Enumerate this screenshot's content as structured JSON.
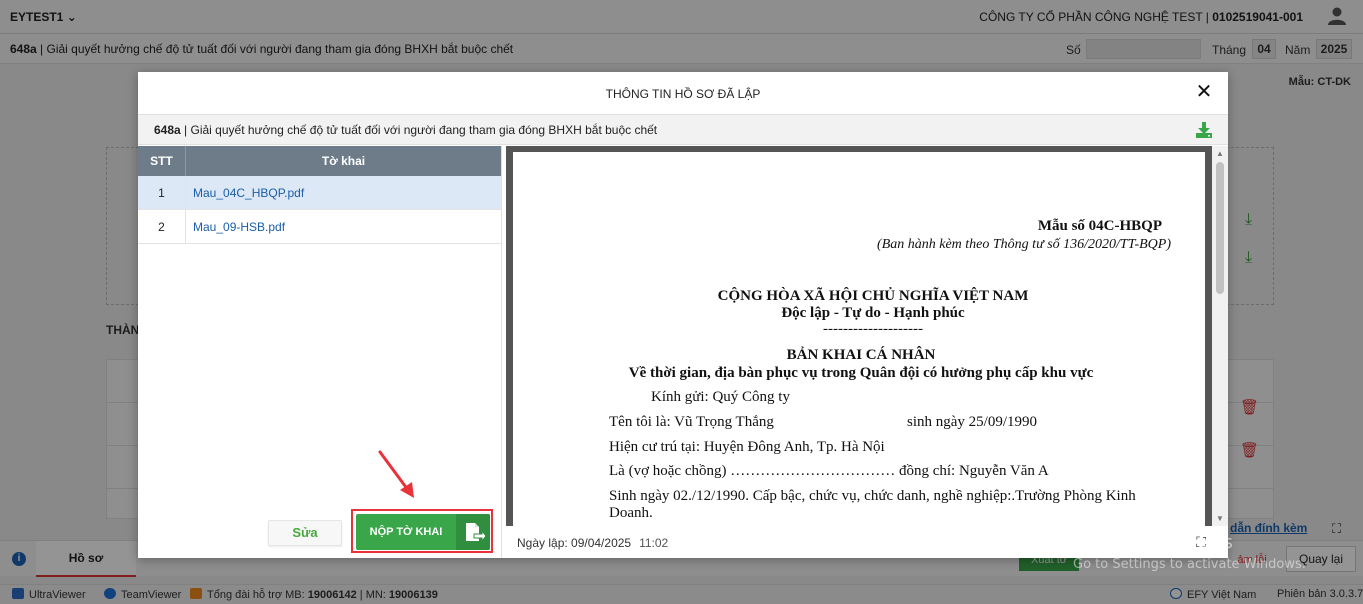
{
  "app": {
    "account": "EYTEST1",
    "company_name": "CÔNG TY CỔ PHẦN CÔNG NGHỆ TEST | ",
    "tax_code": "0102519041-001"
  },
  "form_bar": {
    "code": "648a",
    "title": " | Giải quyết hưởng chế độ tử tuất đối với người đang tham gia đóng BHXH bắt buộc chết",
    "so_label": "Số",
    "so_value": "",
    "thang_label": "Tháng",
    "thang_value": "04",
    "nam_label": "Năm",
    "nam_value": "2025",
    "mau_label": "Mẫu: CT-DK"
  },
  "background": {
    "than_label": "THÀN",
    "tab_hoso": "Hồ sơ",
    "link_dinhkem": "dẫn đính kèm",
    "btn_xuat": "Xuất tờ",
    "btn_kyloi": "ảm lỗi",
    "btn_quaylai": "Quay lại"
  },
  "status_bar": {
    "ultraviewer": "UltraViewer",
    "teamviewer": "TeamViewer",
    "support_prefix": "Tổng đài hỗ trợ MB: ",
    "support_mb": "19006142",
    "support_mid": " | MN: ",
    "support_mn": "19006139",
    "vendor": "EFY Việt Nam",
    "version": "Phiên bản 3.0.3.7"
  },
  "modal": {
    "title": "THÔNG TIN HỒ SƠ ĐÃ LẬP",
    "sub_code": "648a",
    "sub_title": "| Giải quyết hưởng chế độ tử tuất đối với người đang tham gia đóng BHXH bắt buộc chết",
    "table": {
      "headers": [
        "STT",
        "Tờ khai"
      ],
      "rows": [
        {
          "stt": "1",
          "file": "Mau_04C_HBQP.pdf"
        },
        {
          "stt": "2",
          "file": "Mau_09-HSB.pdf"
        }
      ]
    },
    "btn_sua": "Sửa",
    "btn_nop": "NỘP TỜ KHAI",
    "ngay_lap_label": "Ngày lập: 09/04/2025",
    "ngay_lap_time": "11:02"
  },
  "document": {
    "mau_so": "Mẫu số 04C-HBQP",
    "ban_hanh": "(Ban hành kèm theo Thông tư số 136/2020/TT-BQP)",
    "quoc_hieu": "CỘNG HÒA XÃ HỘI CHỦ NGHĨA VIỆT NAM",
    "tieu_ngu": "Độc lập - Tự do - Hạnh phúc",
    "separator": "--------------------",
    "ten_van_ban": "BẢN KHAI CÁ NHÂN",
    "trich_yeu": "Về thời gian, địa bàn phục vụ trong Quân đội có hưởng phụ cấp khu vực",
    "kinh_gui": "Kính gửi: Quý Công ty",
    "ten_toi_la": "Tên tôi là: Vũ Trọng Thắng",
    "sinh_ngay": "sinh ngày 25/09/1990",
    "hien_cu_tru": "Hiện cư trú tại: Huyện Đông Anh, Tp. Hà Nội",
    "vo_chong": "Là (vợ hoặc chồng) …………………………… đồng chí: Nguyễn Văn A",
    "sinh_ngay_2": "Sinh ngày 02./12/1990. Cấp bậc, chức vụ, chức danh, nghề nghiệp:.Trường Phòng Kinh",
    "sinh_ngay_2b": "Doanh."
  },
  "watermark": {
    "line1": "Activate Windows",
    "line2": "Go to Settings to activate Windows."
  },
  "colors": {
    "primary_green": "#3aa64a",
    "header_grey": "#6e7c8a",
    "highlight_red": "#e8333b",
    "link_blue": "#1b5ea8"
  }
}
